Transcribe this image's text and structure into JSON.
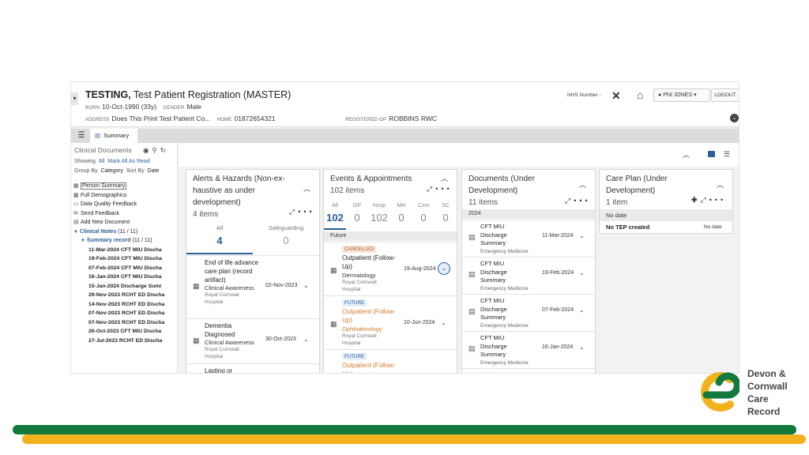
{
  "patient": {
    "surname": "TESTING,",
    "given": "Test Patient Registration (MASTER)",
    "born_label": "BORN",
    "born": "10-Oct-1990 (33y)",
    "gender_label": "GENDER",
    "gender": "Male",
    "address_label": "ADDRESS",
    "address": "Does This Print Test Patient Co...",
    "home_label": "HOME",
    "home": "01872654321",
    "gp_label": "REGISTERED GP",
    "gp": "ROBBINS RWC",
    "nhs_label": "NHS Number -"
  },
  "header": {
    "user": "Phil JONES",
    "logout": "LOGOUT"
  },
  "tabs": {
    "summary": "Summary"
  },
  "leftnav": {
    "title": "Clinical Documents",
    "showing_label": "Showing",
    "showing_value": "All",
    "mark_all": "Mark All As Read",
    "group_label": "Group By",
    "group_value": "Category",
    "sort_label": "Sort By",
    "sort_value": "Date",
    "items": [
      "Person Summary",
      "Full Demographics",
      "Data Quality Feedback",
      "Send Feedback",
      "Add New Document"
    ],
    "clinical_notes": "Clinical Notes",
    "clinical_notes_count": "(11 / 11)",
    "summary_record": "Summary record",
    "summary_record_count": "(11 / 11)",
    "records": [
      {
        "date": "11-Mar-2024",
        "name": "CFT MIU Discha"
      },
      {
        "date": "19-Feb-2024",
        "name": "CFT MIU Discha"
      },
      {
        "date": "07-Feb-2024",
        "name": "CFT MIU Discha"
      },
      {
        "date": "16-Jan-2024",
        "name": "CFT MIU Discha"
      },
      {
        "date": "15-Jan-2024",
        "name": "Discharge Sumi"
      },
      {
        "date": "29-Nov-2023",
        "name": "RCHT ED Discha"
      },
      {
        "date": "14-Nov-2023",
        "name": "RCHT ED Discha"
      },
      {
        "date": "07-Nov-2023",
        "name": "RCHT ED Discha"
      },
      {
        "date": "07-Nov-2023",
        "name": "RCHT ED Discha"
      },
      {
        "date": "26-Oct-2023",
        "name": "CFT MIU Discha"
      },
      {
        "date": "27-Jul-2023",
        "name": "RCHT ED Discha"
      }
    ]
  },
  "alerts": {
    "title": "Alerts & Hazards (Non-ex-haustive as under development)",
    "count": "4 items",
    "tab_all": "All",
    "tab_all_count": "4",
    "tab_safe": "Safeguarding",
    "tab_safe_count": "0",
    "items": [
      {
        "title": "End of life advance care plan (record artifact)",
        "sub": "Clinical Awareness",
        "org": "Royal Cornwall Hospital",
        "date": "02-Nov-2023"
      },
      {
        "title": "Dementia Diagnosed",
        "sub": "Clinical Awareness",
        "org": "Royal Cornwall Hospital",
        "date": "30-Oct-2023"
      },
      {
        "title": "Lasting or",
        "sub": "",
        "org": "",
        "date": ""
      }
    ]
  },
  "events": {
    "title": "Events & Appointments",
    "count": "102 items",
    "filters": [
      {
        "label": "All",
        "n": "102"
      },
      {
        "label": "GP",
        "n": "0"
      },
      {
        "label": "Hosp",
        "n": "102"
      },
      {
        "label": "MH",
        "n": "0"
      },
      {
        "label": "Com",
        "n": "0"
      },
      {
        "label": "SC",
        "n": "0"
      }
    ],
    "group": "Future",
    "items": [
      {
        "badge": "CANCELLED",
        "title": "Outpatient (Follow-Up)",
        "sub": "Dermatology",
        "org": "Royal Cornwall Hospital",
        "date": "19-Aug-2024"
      },
      {
        "badge": "FUTURE",
        "title": "Outpatient (Follow-Up)",
        "sub": "Ophthalmology",
        "org": "Royal Cornwall Hospital",
        "date": "10-Jun-2024"
      },
      {
        "badge": "FUTURE",
        "title": "Outpatient (Follow-Up)",
        "sub": "",
        "org": "",
        "date": ""
      }
    ]
  },
  "documents": {
    "title": "Documents (Under Development)",
    "count": "11 items",
    "group": "2024",
    "items": [
      {
        "title": "CFT MIU Discharge Summary",
        "org": "Emergency Medicine",
        "date": "11-Mar-2024"
      },
      {
        "title": "CFT MIU Discharge Summary",
        "org": "Emergency Medicine",
        "date": "19-Feb-2024"
      },
      {
        "title": "CFT MIU Discharge Summary",
        "org": "Emergency Medicine",
        "date": "07-Feb-2024"
      },
      {
        "title": "CFT MIU Discharge Summary",
        "org": "Emergency Medicine",
        "date": "16-Jan-2024"
      },
      {
        "title": "Discharge",
        "org": "",
        "date": ""
      }
    ]
  },
  "careplan": {
    "title": "Care Plan (Under Development)",
    "count": "1 item",
    "group": "No date",
    "row": "No TEP created",
    "row_date": "No date"
  },
  "logo": {
    "line1": "Devon &",
    "line2": "Cornwall",
    "line3": "Care",
    "line4": "Record"
  },
  "colors": {
    "brand_green": "#127a3c",
    "brand_yellow": "#f2b21d",
    "accent_blue": "#2b5e97",
    "accent_orange": "#d37b2c"
  }
}
